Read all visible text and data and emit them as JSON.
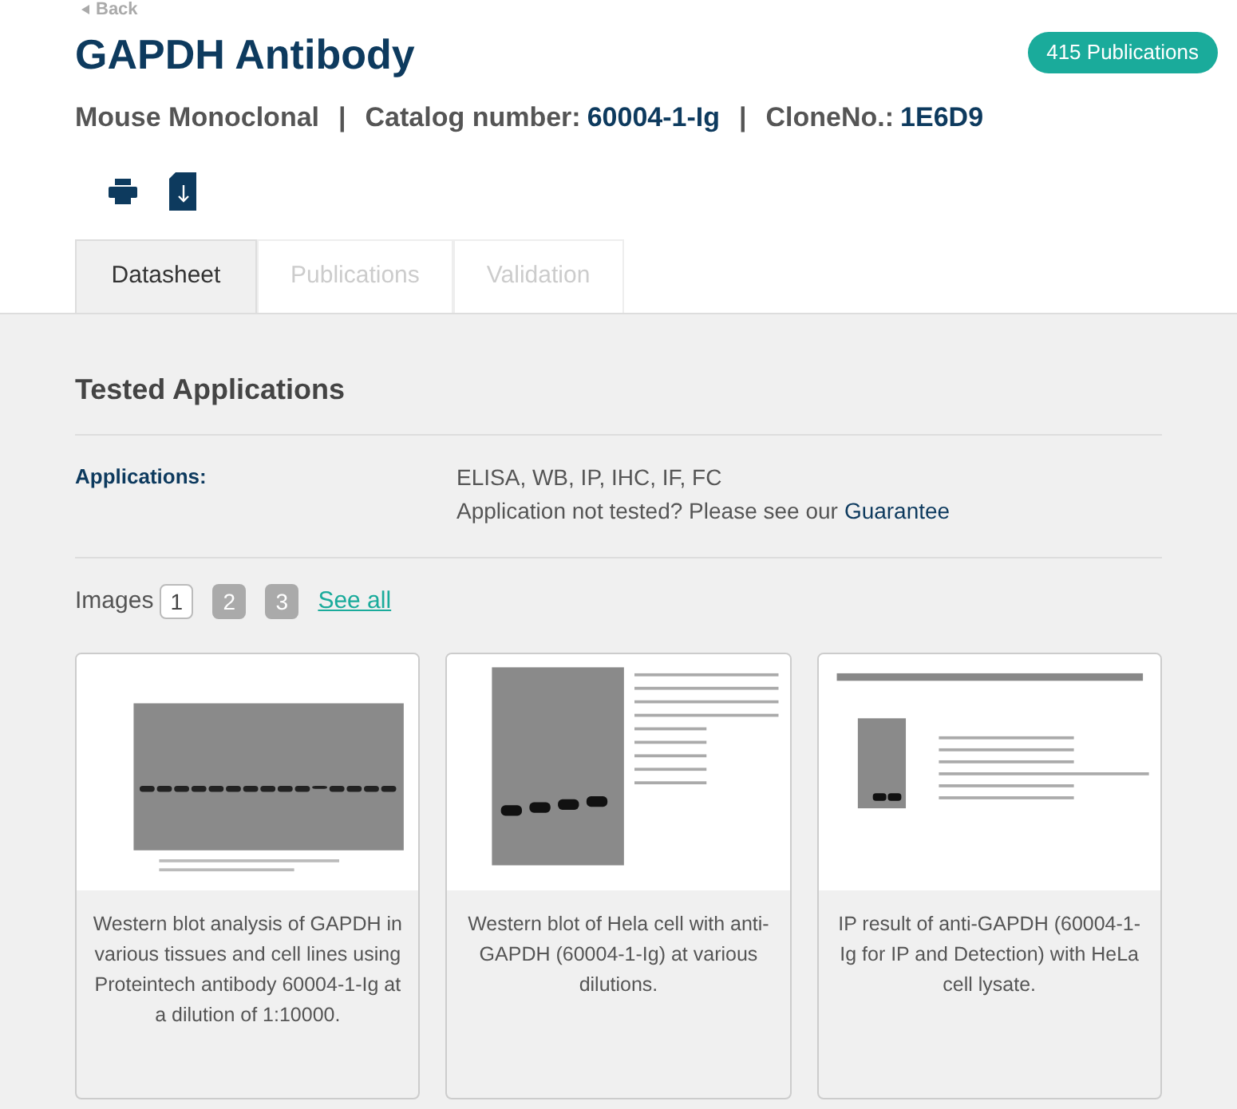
{
  "back_link": "Back",
  "title": "GAPDH Antibody",
  "publications_badge": "415 Publications",
  "meta": [
    {
      "label": "Mouse Monoclonal"
    },
    {
      "label": "Catalog number:",
      "value": "60004-1-Ig"
    },
    {
      "label": "CloneNo.:",
      "value": "1E6D9"
    }
  ],
  "separator": "|",
  "tabs": [
    {
      "label": "Datasheet",
      "selected": true
    },
    {
      "label": "Publications",
      "selected": false
    },
    {
      "label": "Validation",
      "selected": false
    }
  ],
  "section_title": "Tested Applications",
  "applications": {
    "label": "Applications:",
    "value": "ELISA, WB, IP, IHC, IF, FC",
    "note": "Application not tested? Please see our",
    "link": "Guarantee"
  },
  "images": {
    "label": "Images",
    "pages": [
      {
        "label": "1",
        "selected": true
      },
      {
        "label": "2",
        "selected": false
      },
      {
        "label": "3",
        "selected": false
      }
    ],
    "see_all": "See all",
    "cards": [
      {
        "kind": "tissues",
        "caption": "Western blot analysis of GAPDH in various tissues and cell lines using Proteintech antibody 60004-1-Ig at a dilution of 1:10000."
      },
      {
        "kind": "dilution",
        "caption": "Western blot of Hela cell with anti-GAPDH (60004-1-Ig) at various dilutions."
      },
      {
        "kind": "ip",
        "caption": "IP result of anti-GAPDH (60004-1-Ig for IP and Detection) with HeLa cell lysate."
      }
    ]
  }
}
